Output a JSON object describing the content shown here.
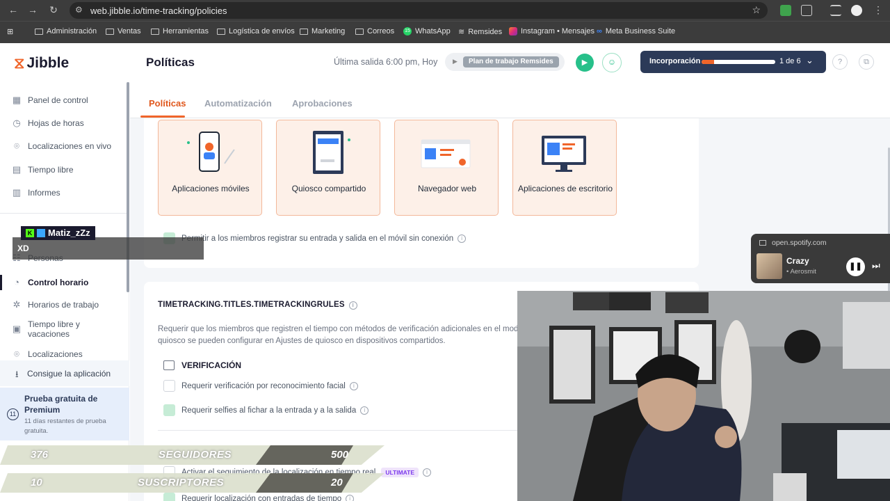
{
  "browser": {
    "url": "web.jibble.io/time-tracking/policies",
    "bookmarks": [
      "Administración",
      "Ventas",
      "Herramientas",
      "Logística de envíos",
      "Marketing",
      "Correos",
      "WhatsApp",
      "Remsides",
      "Instagram • Mensajes",
      "Meta Business Suite"
    ],
    "whatsapp_badge": "15"
  },
  "app": {
    "logo": "Jibble",
    "page_title": "Políticas",
    "last_out": "Última salida 6:00 pm, Hoy",
    "plan_tag": "Plan de trabajo Remsides",
    "onboarding": {
      "label": "Incorporación",
      "progress": 0.17,
      "count": "1 de 6"
    }
  },
  "sidebar": {
    "items": [
      {
        "label": "Panel de control",
        "icon": "dashboard-icon"
      },
      {
        "label": "Hojas de horas",
        "icon": "clock-icon"
      },
      {
        "label": "Localizaciones en vivo",
        "icon": "location-pin-icon"
      },
      {
        "label": "Tiempo libre",
        "icon": "calendar-icon"
      },
      {
        "label": "Informes",
        "icon": "report-icon"
      }
    ],
    "items2": [
      {
        "label": "Personas",
        "icon": "people-icon"
      },
      {
        "label": "Control horario",
        "icon": "time-tracking-icon",
        "active": true
      },
      {
        "label": "Horarios de trabajo",
        "icon": "schedule-icon"
      },
      {
        "label": "Tiempo libre y vacaciones",
        "icon": "vacation-icon"
      },
      {
        "label": "Localizaciones",
        "icon": "location-pin-icon"
      }
    ],
    "get_app": "Consigue la aplicación",
    "premium_title": "Prueba gratuita de Premium",
    "premium_sub": "11 días restantes de prueba gratuita.",
    "premium_days": "11"
  },
  "tabs": [
    "Políticas",
    "Automatización",
    "Aprobaciones"
  ],
  "methods": [
    "Aplicaciones móviles",
    "Quiosco compartido",
    "Navegador web",
    "Aplicaciones de escritorio"
  ],
  "offline_option": "Permitir a los miembros registrar su entrada y salida en el móvil sin conexión",
  "rules": {
    "title": "TIMETRACKING.TITLES.TIMETRACKINGRULES",
    "description": "Requerir que los miembros que registren el tiempo con métodos de verificación adicionales en el modo quiosco se pueden configurar en Ajustes de quiosco en dispositivos compartidos.",
    "verification_title": "VERIFICACIÓN",
    "face": "Requerir verificación por reconocimiento facial",
    "selfie": "Requerir selfies al fichar a la entrada y a la salida",
    "location_tracking": "Activar el seguimiento de la localización en tiempo real",
    "ultimate_badge": "ULTIMATE",
    "location_required": "Requerir localización con entradas de tiempo"
  },
  "overlay": {
    "streamer": "Matiz_zZz",
    "chat": "XD",
    "spotify": {
      "source": "open.spotify.com",
      "song": "Crazy",
      "artist": "• Aerosmit"
    },
    "counters": [
      {
        "current": "376",
        "label": "SEGUIDORES",
        "goal": "500"
      },
      {
        "current": "10",
        "label": "SUSCRIPTORES",
        "goal": "20"
      }
    ]
  }
}
